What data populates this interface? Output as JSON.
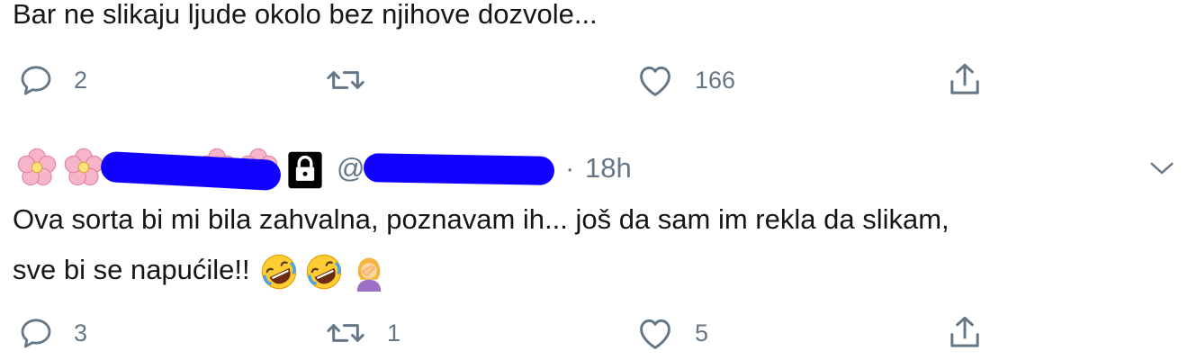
{
  "tweets": [
    {
      "text": "Bar ne slikaju ljude okolo bez njihove dozvole...",
      "actions": {
        "reply_count": "2",
        "retweet_count": "",
        "like_count": "166"
      }
    },
    {
      "handle_prefix": "@",
      "separator": "·",
      "time": "18h",
      "text_line1": "Ova sorta bi mi bila zahvalna, poznavam ih... još da sam im rekla da slikam,",
      "text_line2": "sve bi se napućile!!",
      "emojis": [
        "rolling-on-floor-laughing",
        "rolling-on-floor-laughing",
        "woman-facepalming"
      ],
      "actions": {
        "reply_count": "3",
        "retweet_count": "1",
        "like_count": "5"
      }
    }
  ],
  "colors": {
    "text": "#14171a",
    "secondary": "#657786",
    "redaction": "#1200ff"
  },
  "icons": [
    "reply-icon",
    "retweet-icon",
    "like-icon",
    "share-icon",
    "lock-icon",
    "chevron-down-icon",
    "cherry-blossom-icon"
  ]
}
